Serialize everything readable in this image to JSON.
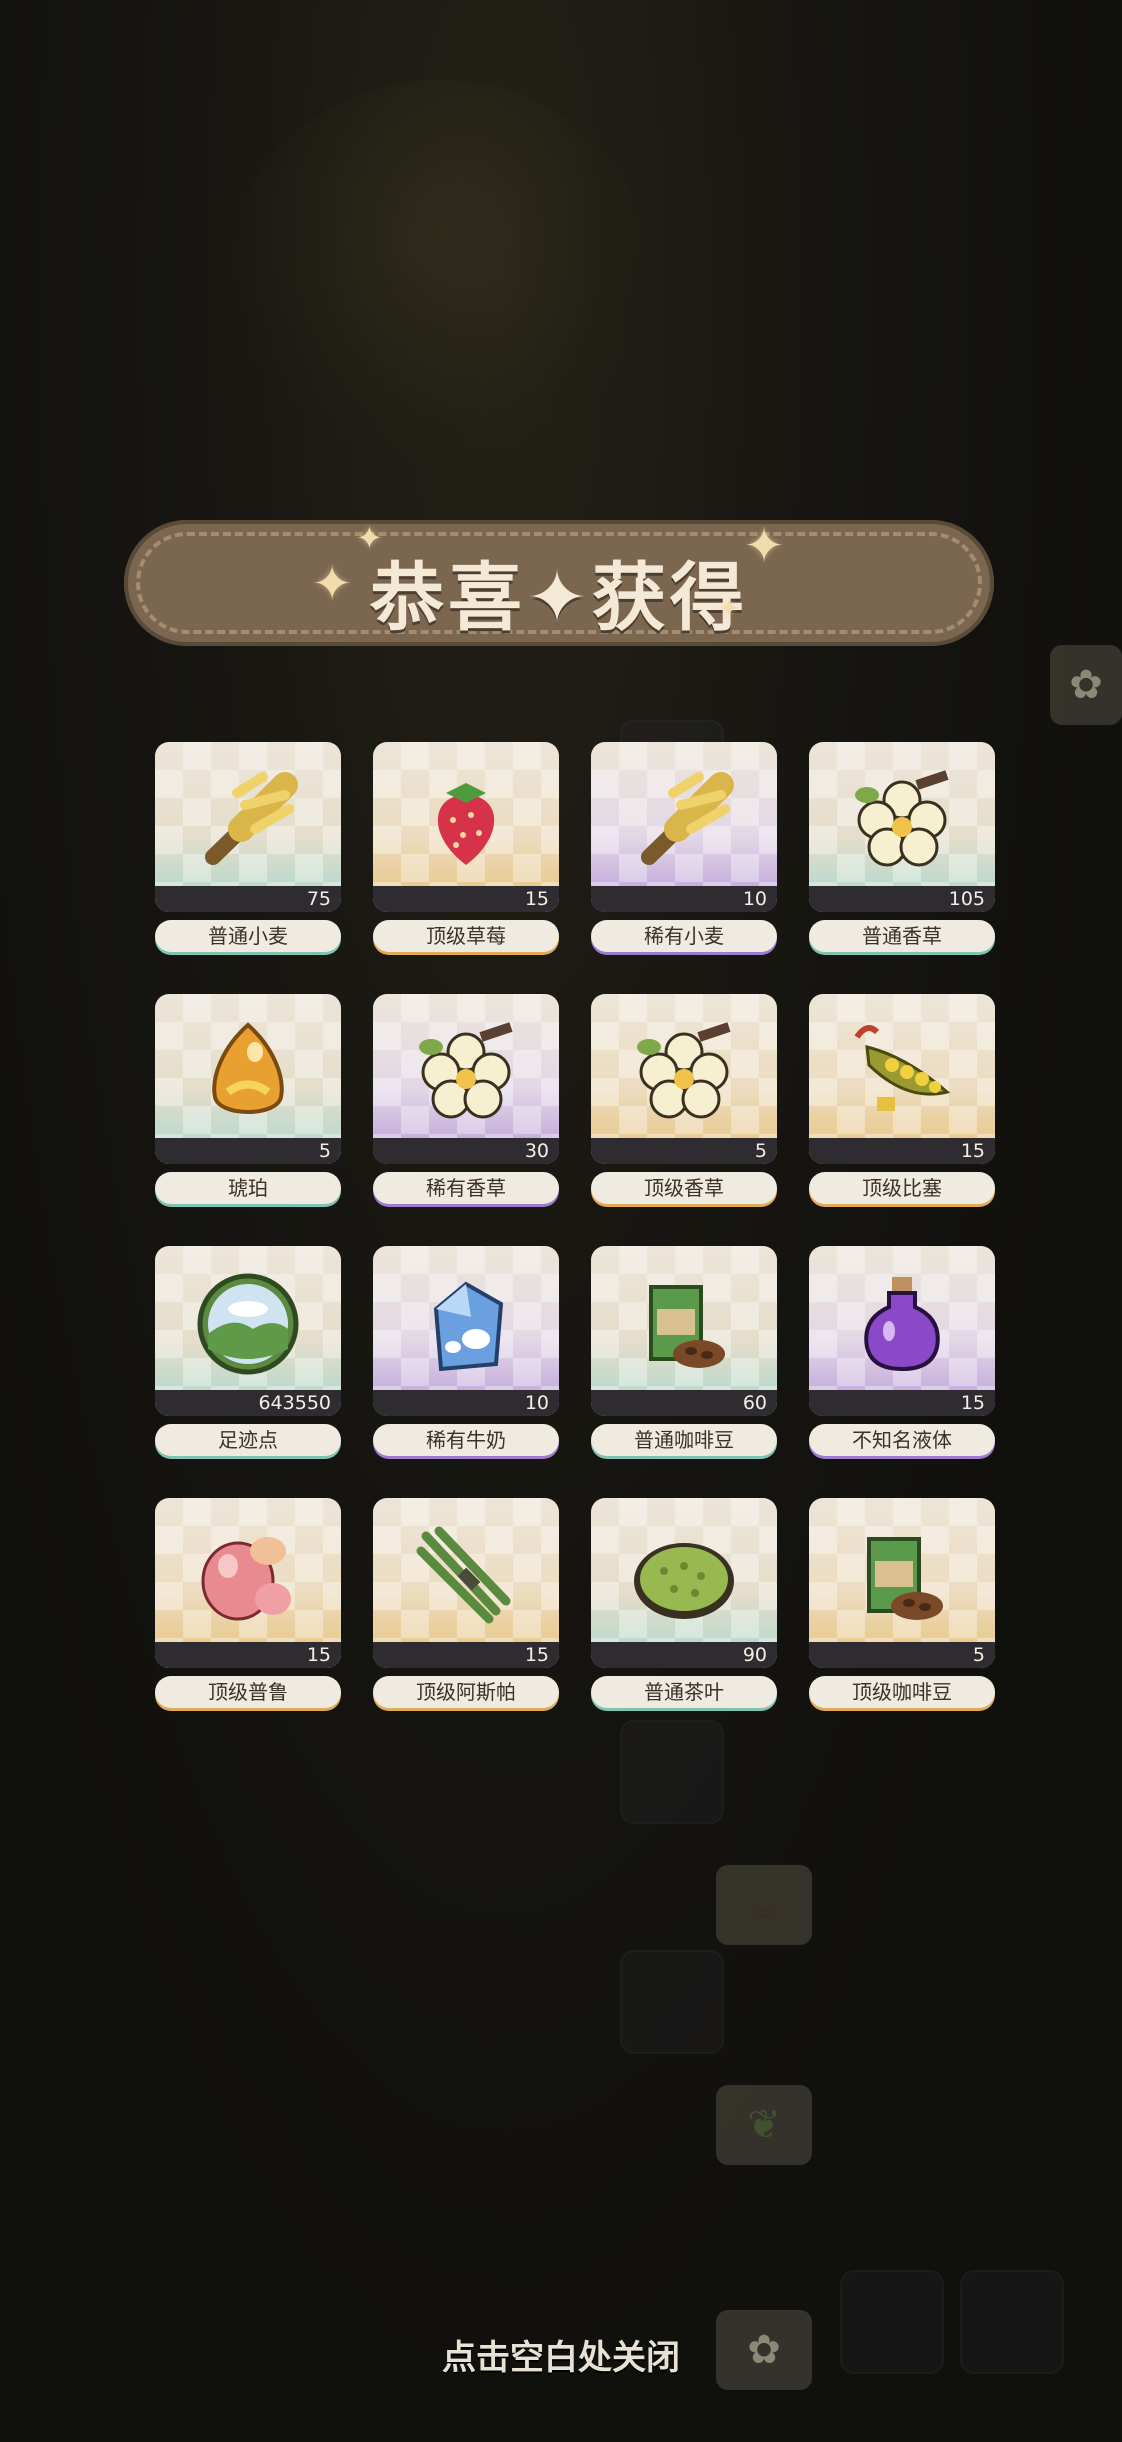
{
  "banner": {
    "title": "恭喜✦获得"
  },
  "rewards": [
    {
      "name": "普通小麦",
      "count": "75",
      "rarity": "common",
      "icon": "wheat-icon"
    },
    {
      "name": "顶级草莓",
      "count": "15",
      "rarity": "top",
      "icon": "strawberry-icon"
    },
    {
      "name": "稀有小麦",
      "count": "10",
      "rarity": "rare",
      "icon": "wheat-icon"
    },
    {
      "name": "普通香草",
      "count": "105",
      "rarity": "common",
      "icon": "vanilla-flower-icon"
    },
    {
      "name": "琥珀",
      "count": "5",
      "rarity": "common",
      "icon": "amber-icon"
    },
    {
      "name": "稀有香草",
      "count": "30",
      "rarity": "rare",
      "icon": "vanilla-flower-icon"
    },
    {
      "name": "顶级香草",
      "count": "5",
      "rarity": "top",
      "icon": "vanilla-flower-icon"
    },
    {
      "name": "顶级比塞",
      "count": "15",
      "rarity": "top",
      "icon": "pea-pod-icon"
    },
    {
      "name": "足迹点",
      "count": "643550",
      "rarity": "common",
      "icon": "landscape-orb-icon"
    },
    {
      "name": "稀有牛奶",
      "count": "10",
      "rarity": "rare",
      "icon": "milk-carton-icon"
    },
    {
      "name": "普通咖啡豆",
      "count": "60",
      "rarity": "common",
      "icon": "coffee-bag-icon"
    },
    {
      "name": "不知名液体",
      "count": "15",
      "rarity": "rare",
      "icon": "potion-bottle-icon"
    },
    {
      "name": "顶级普鲁",
      "count": "15",
      "rarity": "top",
      "icon": "pink-fruit-icon"
    },
    {
      "name": "顶级阿斯帕",
      "count": "15",
      "rarity": "top",
      "icon": "asparagus-icon"
    },
    {
      "name": "普通茶叶",
      "count": "90",
      "rarity": "common",
      "icon": "tea-leaves-bowl-icon"
    },
    {
      "name": "顶级咖啡豆",
      "count": "5",
      "rarity": "top",
      "icon": "coffee-bag-icon"
    }
  ],
  "footer": {
    "close_hint": "点击空白处关闭"
  },
  "colors": {
    "common_accent": "#7fc3b2",
    "rare_accent": "#9f7ad1",
    "top_accent": "#e0ab55",
    "banner": "#7b6650"
  }
}
